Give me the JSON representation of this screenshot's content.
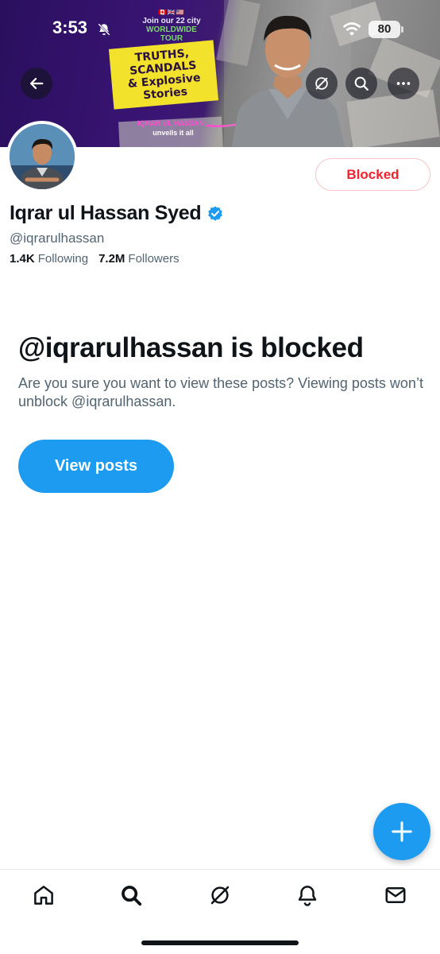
{
  "status_bar": {
    "time": "3:53",
    "battery": "80"
  },
  "banner": {
    "promo_flags": "🇨🇦🇬🇧🇺🇸",
    "promo_join": "Join our 22 city",
    "promo_tour": "WORLDWIDE TOUR",
    "headline_line1": "TRUTHS,",
    "headline_line2": "SCANDALS",
    "headline_line3": "& Explosive",
    "headline_line4": "Stories",
    "promo_name": "IQRAR UL HASSAN",
    "promo_sub": "unveils it all"
  },
  "profile": {
    "display_name": "Iqrar ul Hassan Syed",
    "handle": "@iqrarulhassan",
    "following_count": "1.4K",
    "following_label": "Following",
    "followers_count": "7.2M",
    "followers_label": "Followers",
    "blocked_button": "Blocked"
  },
  "blocked_notice": {
    "title": "@iqrarulhassan is blocked",
    "description": "Are you sure you want to view these posts? Viewing posts won’t unblock @iqrarulhassan.",
    "view_posts_button": "View posts"
  },
  "colors": {
    "accent": "#1d9bf0",
    "blocked_red": "#f4212e",
    "secondary_text": "#536471"
  },
  "icons": {
    "back": "arrow-left-icon",
    "grok": "grok-icon",
    "search": "search-icon",
    "more": "more-icon",
    "verified": "verified-badge-icon",
    "compose": "plus-icon",
    "nav": [
      "home-icon",
      "search-icon",
      "grok-icon",
      "bell-icon",
      "mail-icon"
    ]
  }
}
